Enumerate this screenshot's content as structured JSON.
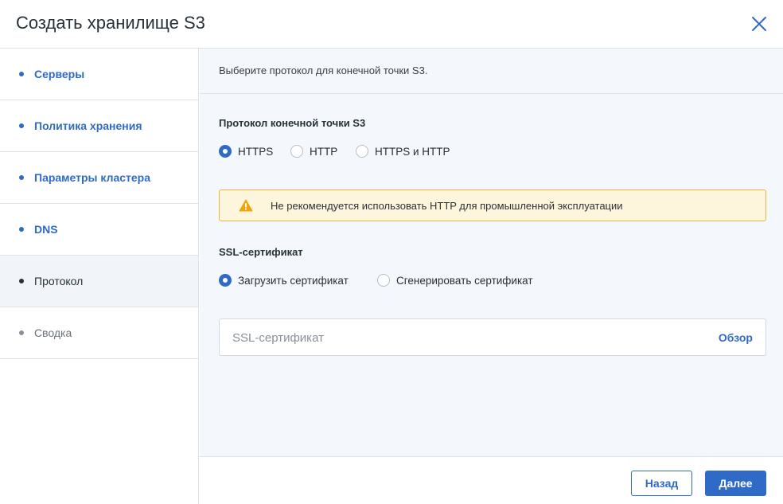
{
  "header": {
    "title": "Создать хранилище S3"
  },
  "sidebar": {
    "steps": [
      {
        "label": "Серверы",
        "state": "done"
      },
      {
        "label": "Политика хранения",
        "state": "done"
      },
      {
        "label": "Параметры кластера",
        "state": "done"
      },
      {
        "label": "DNS",
        "state": "done"
      },
      {
        "label": "Протокол",
        "state": "active"
      },
      {
        "label": "Сводка",
        "state": "pending"
      }
    ]
  },
  "main": {
    "intro": "Выберите протокол для конечной точки S3.",
    "protocol": {
      "title": "Протокол конечной точки S3",
      "options": [
        {
          "label": "HTTPS",
          "checked": true
        },
        {
          "label": "HTTP",
          "checked": false
        },
        {
          "label": "HTTPS и HTTP",
          "checked": false
        }
      ]
    },
    "warning": {
      "icon": "warning-icon",
      "text": "Не рекомендуется использовать HTTP для промышленной эксплуатации"
    },
    "ssl": {
      "title": "SSL-сертификат",
      "options": [
        {
          "label": "Загрузить сертификат",
          "checked": true
        },
        {
          "label": "Сгенерировать сертификат",
          "checked": false
        }
      ],
      "field_placeholder": "SSL-сертификат",
      "browse_label": "Обзор"
    }
  },
  "footer": {
    "back_label": "Назад",
    "next_label": "Далее"
  },
  "colors": {
    "accent": "#2f6bc6",
    "warning_bg": "#fdf6dd",
    "warning_border": "#e8b43a",
    "warning_icon": "#f0a30a"
  }
}
